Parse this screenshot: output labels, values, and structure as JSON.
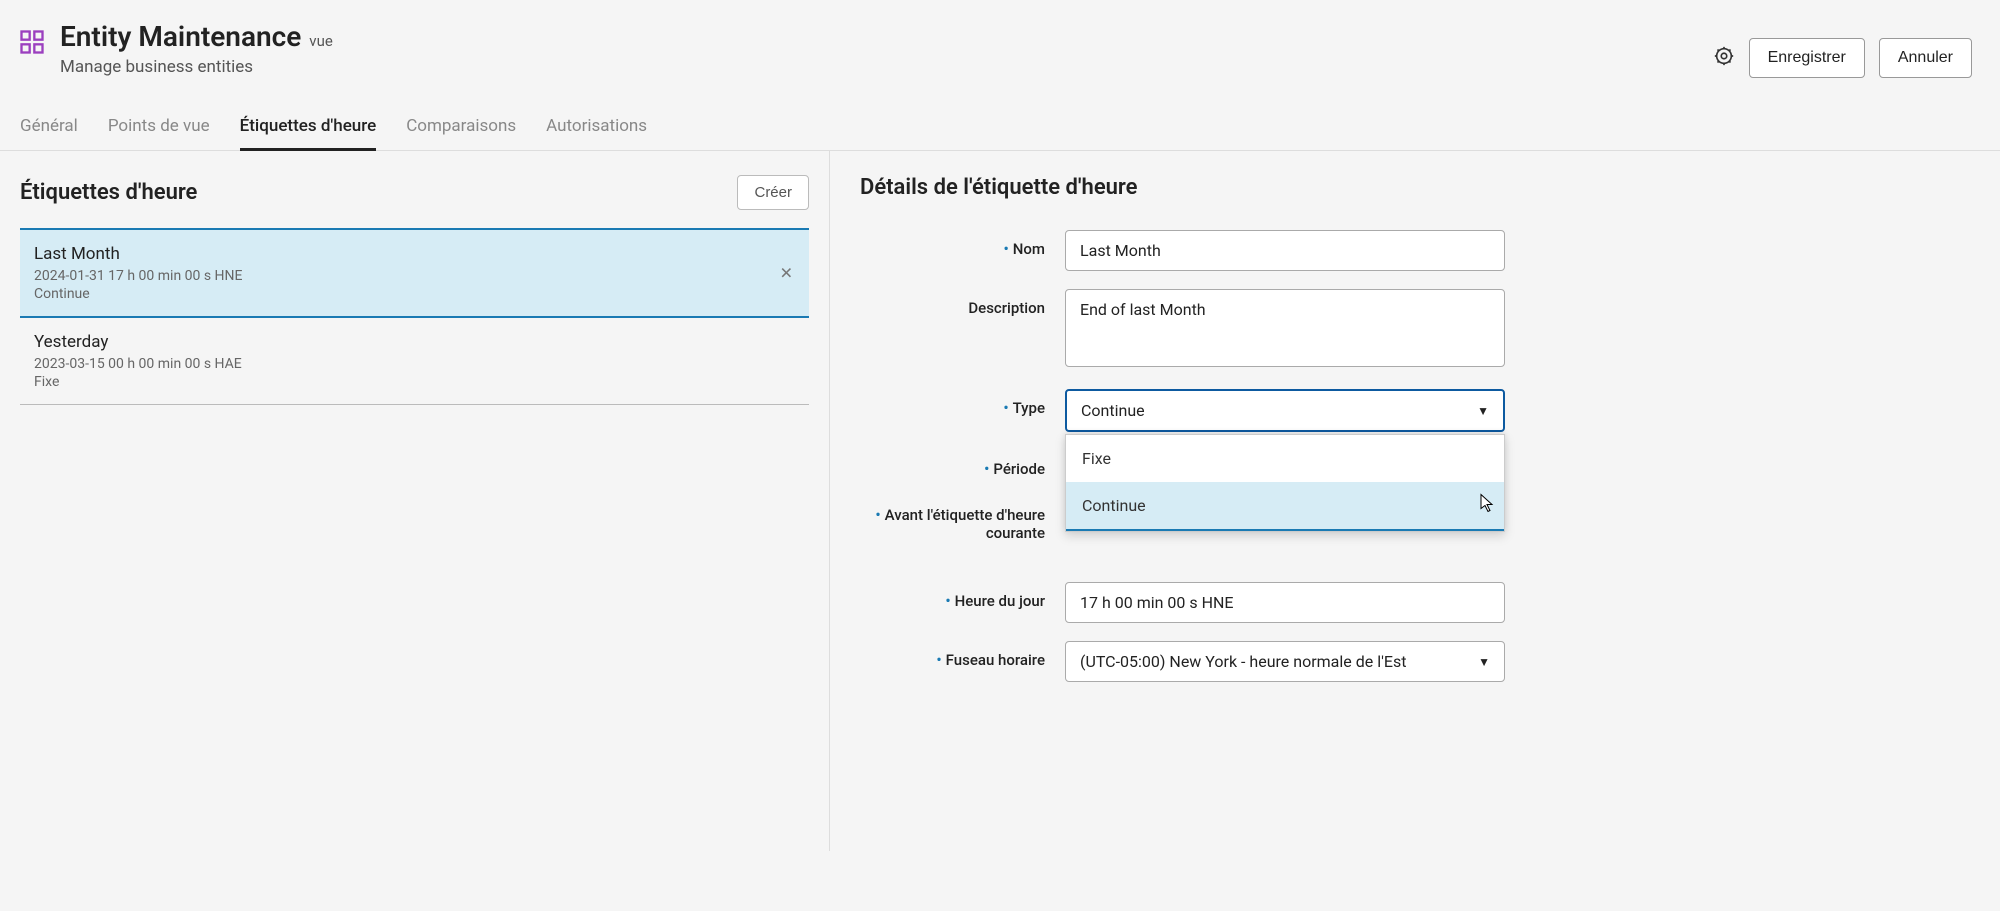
{
  "header": {
    "title": "Entity Maintenance",
    "title_suffix": "vue",
    "subtitle": "Manage business entities",
    "save_label": "Enregistrer",
    "cancel_label": "Annuler"
  },
  "tabs": [
    {
      "label": "Général"
    },
    {
      "label": "Points de vue"
    },
    {
      "label": "Étiquettes d'heure"
    },
    {
      "label": "Comparaisons"
    },
    {
      "label": "Autorisations"
    }
  ],
  "active_tab_index": 2,
  "left": {
    "title": "Étiquettes d'heure",
    "create_label": "Créer",
    "items": [
      {
        "name": "Last Month",
        "timestamp": "2024-01-31 17 h 00 min 00 s HNE",
        "type": "Continue",
        "selected": true
      },
      {
        "name": "Yesterday",
        "timestamp": "2023-03-15 00 h 00 min 00 s HAE",
        "type": "Fixe",
        "selected": false
      }
    ]
  },
  "details": {
    "title": "Détails de l'étiquette d'heure",
    "fields": {
      "name": {
        "label": "Nom",
        "value": "Last Month",
        "required": true
      },
      "description": {
        "label": "Description",
        "value": "End of last Month",
        "required": false
      },
      "type": {
        "label": "Type",
        "value": "Continue",
        "required": true,
        "options": [
          "Fixe",
          "Continue"
        ],
        "open": true,
        "highlighted": "Continue"
      },
      "period": {
        "label": "Période",
        "required": true
      },
      "before_current": {
        "label": "Avant l'étiquette d'heure courante",
        "required": true
      },
      "time_of_day": {
        "label": "Heure du jour",
        "value": "17 h 00 min 00 s HNE",
        "required": true
      },
      "timezone": {
        "label": "Fuseau horaire",
        "value": "(UTC-05:00) New York - heure normale de l'Est",
        "required": true
      }
    }
  }
}
